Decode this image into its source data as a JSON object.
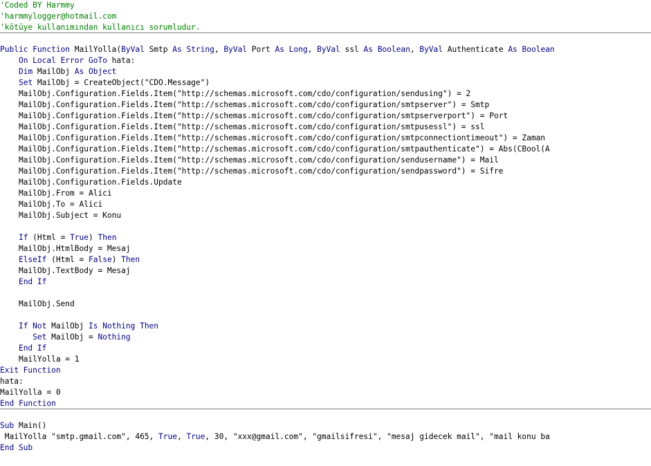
{
  "colors": {
    "keyword": "#00008b",
    "comment": "#008000",
    "text": "#000000",
    "separator": "#808080"
  },
  "code_lines": [
    [
      {
        "t": "'Coded BY Harmmy",
        "c": "cm"
      }
    ],
    [
      {
        "t": "'harmmylogger@hotmail.com",
        "c": "cm"
      }
    ],
    [
      {
        "t": "'kötüye kullanımından kullanıcı sorumludur.",
        "c": "cm"
      }
    ],
    [],
    [
      {
        "t": "Public Function ",
        "c": "kw"
      },
      {
        "t": "MailYolla(",
        "c": "tx"
      },
      {
        "t": "ByVal ",
        "c": "kw"
      },
      {
        "t": "Smtp ",
        "c": "tx"
      },
      {
        "t": "As String",
        "c": "kw"
      },
      {
        "t": ", ",
        "c": "tx"
      },
      {
        "t": "ByVal ",
        "c": "kw"
      },
      {
        "t": "Port ",
        "c": "tx"
      },
      {
        "t": "As Long",
        "c": "kw"
      },
      {
        "t": ", ",
        "c": "tx"
      },
      {
        "t": "ByVal ",
        "c": "kw"
      },
      {
        "t": "ssl ",
        "c": "tx"
      },
      {
        "t": "As Boolean",
        "c": "kw"
      },
      {
        "t": ", ",
        "c": "tx"
      },
      {
        "t": "ByVal ",
        "c": "kw"
      },
      {
        "t": "Authenticate ",
        "c": "tx"
      },
      {
        "t": "As Boolean",
        "c": "kw"
      }
    ],
    [
      {
        "t": "    ",
        "c": "tx"
      },
      {
        "t": "On Local Error GoTo ",
        "c": "kw"
      },
      {
        "t": "hata:",
        "c": "tx"
      }
    ],
    [
      {
        "t": "    ",
        "c": "tx"
      },
      {
        "t": "Dim ",
        "c": "kw"
      },
      {
        "t": "MailObj ",
        "c": "tx"
      },
      {
        "t": "As Object",
        "c": "kw"
      }
    ],
    [
      {
        "t": "    ",
        "c": "tx"
      },
      {
        "t": "Set ",
        "c": "kw"
      },
      {
        "t": "MailObj = CreateObject(\"CDO.Message\")",
        "c": "tx"
      }
    ],
    [
      {
        "t": "    MailObj.Configuration.Fields.Item(\"http://schemas.microsoft.com/cdo/configuration/sendusing\") = 2",
        "c": "tx"
      }
    ],
    [
      {
        "t": "    MailObj.Configuration.Fields.Item(\"http://schemas.microsoft.com/cdo/configuration/smtpserver\") = Smtp",
        "c": "tx"
      }
    ],
    [
      {
        "t": "    MailObj.Configuration.Fields.Item(\"http://schemas.microsoft.com/cdo/configuration/smtpserverport\") = Port",
        "c": "tx"
      }
    ],
    [
      {
        "t": "    MailObj.Configuration.Fields.Item(\"http://schemas.microsoft.com/cdo/configuration/smtpusessl\") = ssl",
        "c": "tx"
      }
    ],
    [
      {
        "t": "    MailObj.Configuration.Fields.Item(\"http://schemas.microsoft.com/cdo/configuration/smtpconnectiontimeout\") = Zaman",
        "c": "tx"
      }
    ],
    [
      {
        "t": "    MailObj.Configuration.Fields.Item(\"http://schemas.microsoft.com/cdo/configuration/smtpauthenticate\") = Abs(CBool(A",
        "c": "tx"
      }
    ],
    [
      {
        "t": "    MailObj.Configuration.Fields.Item(\"http://schemas.microsoft.com/cdo/configuration/sendusername\") = Mail",
        "c": "tx"
      }
    ],
    [
      {
        "t": "    MailObj.Configuration.Fields.Item(\"http://schemas.microsoft.com/cdo/configuration/sendpassword\") = Sifre",
        "c": "tx"
      }
    ],
    [
      {
        "t": "    MailObj.Configuration.Fields.Update",
        "c": "tx"
      }
    ],
    [
      {
        "t": "    MailObj.From = Alici",
        "c": "tx"
      }
    ],
    [
      {
        "t": "    MailObj.To = Alici",
        "c": "tx"
      }
    ],
    [
      {
        "t": "    MailObj.Subject = Konu",
        "c": "tx"
      }
    ],
    [],
    [
      {
        "t": "    ",
        "c": "tx"
      },
      {
        "t": "If ",
        "c": "kw"
      },
      {
        "t": "(Html = ",
        "c": "tx"
      },
      {
        "t": "True",
        "c": "kw"
      },
      {
        "t": ") ",
        "c": "tx"
      },
      {
        "t": "Then",
        "c": "kw"
      }
    ],
    [
      {
        "t": "    MailObj.HtmlBody = Mesaj",
        "c": "tx"
      }
    ],
    [
      {
        "t": "    ",
        "c": "tx"
      },
      {
        "t": "ElseIf ",
        "c": "kw"
      },
      {
        "t": "(Html = ",
        "c": "tx"
      },
      {
        "t": "False",
        "c": "kw"
      },
      {
        "t": ") ",
        "c": "tx"
      },
      {
        "t": "Then",
        "c": "kw"
      }
    ],
    [
      {
        "t": "    MailObj.TextBody = Mesaj",
        "c": "tx"
      }
    ],
    [
      {
        "t": "    ",
        "c": "tx"
      },
      {
        "t": "End If",
        "c": "kw"
      }
    ],
    [],
    [
      {
        "t": "    MailObj.Send",
        "c": "tx"
      }
    ],
    [],
    [
      {
        "t": "    ",
        "c": "tx"
      },
      {
        "t": "If Not ",
        "c": "kw"
      },
      {
        "t": "MailObj ",
        "c": "tx"
      },
      {
        "t": "Is Nothing Then",
        "c": "kw"
      }
    ],
    [
      {
        "t": "       ",
        "c": "tx"
      },
      {
        "t": "Set ",
        "c": "kw"
      },
      {
        "t": "MailObj = ",
        "c": "tx"
      },
      {
        "t": "Nothing",
        "c": "kw"
      }
    ],
    [
      {
        "t": "    ",
        "c": "tx"
      },
      {
        "t": "End If",
        "c": "kw"
      }
    ],
    [
      {
        "t": "    MailYolla = 1",
        "c": "tx"
      }
    ],
    [
      {
        "t": "Exit Function",
        "c": "kw"
      }
    ],
    [
      {
        "t": "hata:",
        "c": "tx"
      }
    ],
    [
      {
        "t": "MailYolla = 0",
        "c": "tx"
      }
    ],
    [
      {
        "t": "End Function",
        "c": "kw"
      }
    ],
    [],
    [
      {
        "t": "Sub ",
        "c": "kw"
      },
      {
        "t": "Main()",
        "c": "tx"
      }
    ],
    [
      {
        "t": " MailYolla \"smtp.gmail.com\", 465, ",
        "c": "tx"
      },
      {
        "t": "True",
        "c": "kw"
      },
      {
        "t": ", ",
        "c": "tx"
      },
      {
        "t": "True",
        "c": "kw"
      },
      {
        "t": ", 30, \"xxx@gmail.com\", \"gmailsifresi\", \"mesaj gidecek mail\", \"mail konu ba",
        "c": "tx"
      }
    ],
    [
      {
        "t": "End Sub",
        "c": "kw"
      }
    ]
  ]
}
